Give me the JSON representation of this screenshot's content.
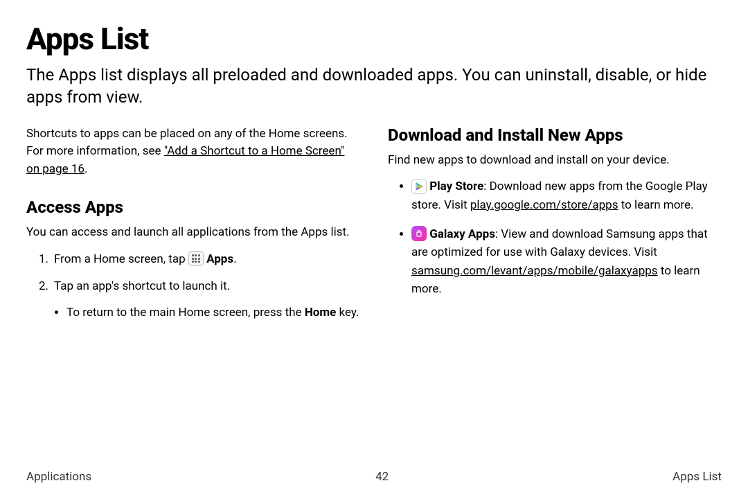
{
  "title": "Apps List",
  "intro": "The Apps list displays all preloaded and downloaded apps. You can uninstall, disable, or hide apps from view.",
  "leftCol": {
    "shortcutNotePrefix": "Shortcuts to apps can be placed on any of the Home screens. For more information, see ",
    "shortcutLink": "\"Add a Shortcut to a Home Screen\" on page 16",
    "shortcutNoteSuffix": ".",
    "accessApps": {
      "heading": "Access Apps",
      "desc": "You can access and launch all applications from the Apps list.",
      "step1_prefix": "From a Home screen, tap ",
      "step1_label": "Apps",
      "step1_suffix": ".",
      "step2": "Tap an app's shortcut to launch it.",
      "sub_prefix": "To return to the main Home screen, press the ",
      "sub_bold": "Home",
      "sub_suffix": " key."
    }
  },
  "rightCol": {
    "heading": "Download and Install New Apps",
    "desc": "Find new apps to download and install on your device.",
    "playStore": {
      "label": "Play Store",
      "bodyPrefix": ": Download new apps from the Google Play store. Visit ",
      "link": "play.google.com/store/apps",
      "bodySuffix": " to learn more."
    },
    "galaxyApps": {
      "label": "Galaxy Apps",
      "bodyPrefix": ": View and download Samsung apps that are optimized for use with Galaxy devices. Visit ",
      "link": "samsung.com/levant/apps/mobile/galaxyapps",
      "bodySuffix": " to learn more."
    }
  },
  "footer": {
    "left": "Applications",
    "center": "42",
    "right": "Apps List"
  }
}
